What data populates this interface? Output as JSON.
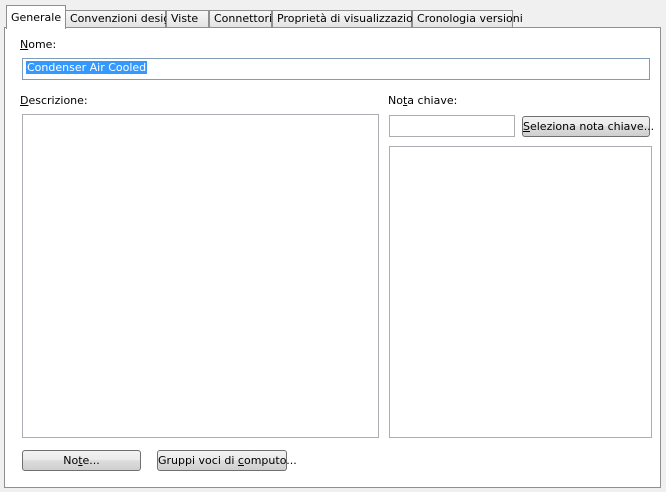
{
  "tabs": [
    {
      "label": "Generale",
      "active": true
    },
    {
      "label": "Convenzioni design"
    },
    {
      "label": "Viste"
    },
    {
      "label": "Connettori"
    },
    {
      "label": "Proprietà di visualizzazione"
    },
    {
      "label": "Cronologia versioni"
    }
  ],
  "name": {
    "label_pre": "",
    "label_u": "N",
    "label_post": "ome:",
    "value": "Condenser Air Cooled"
  },
  "description": {
    "label_pre": "",
    "label_u": "D",
    "label_post": "escrizione:",
    "value": ""
  },
  "keynote": {
    "label_pre": "No",
    "label_u": "t",
    "label_post": "a chiave:",
    "value": "",
    "select_pre": "",
    "select_u": "S",
    "select_post": "eleziona nota chiave...",
    "list_value": ""
  },
  "buttons": {
    "notes_pre": "No",
    "notes_u": "t",
    "notes_post": "e...",
    "groups_pre": "Gruppi voci di ",
    "groups_u": "c",
    "groups_post": "omputo..."
  },
  "colors": {
    "selection": "#3399ff",
    "field_border": "#7f9db9"
  }
}
